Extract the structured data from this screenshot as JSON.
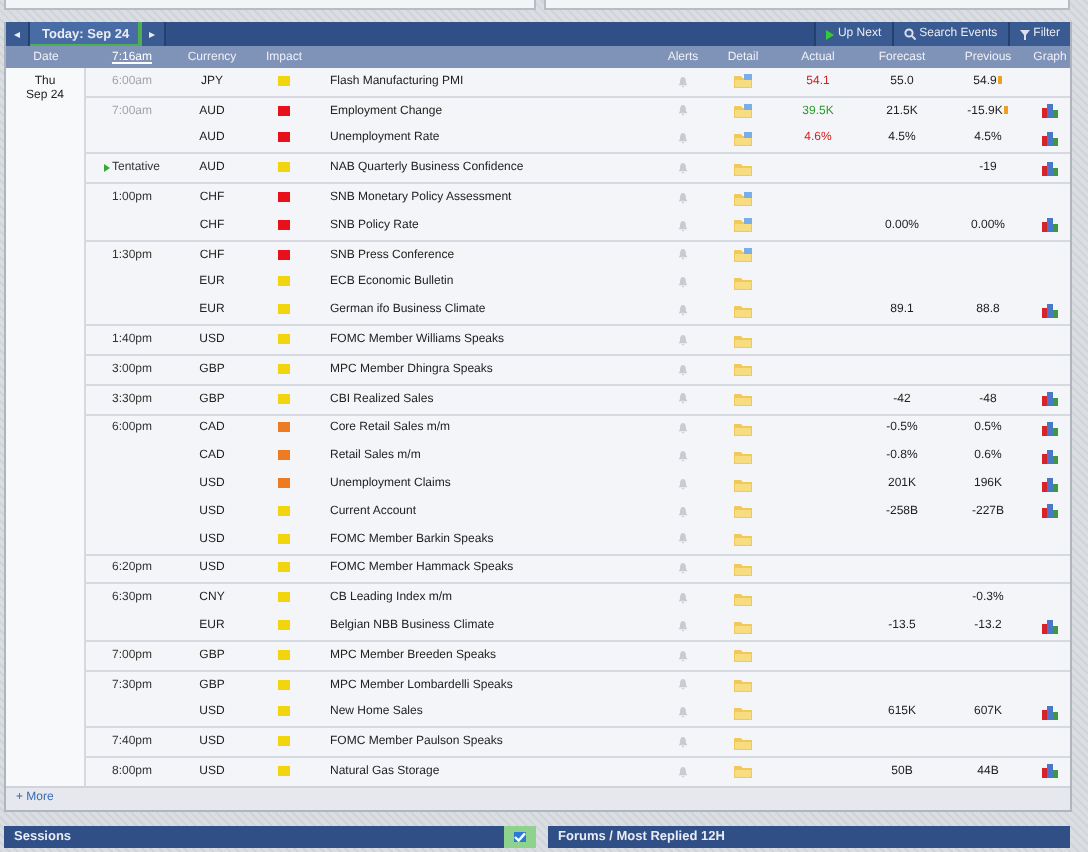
{
  "nav": {
    "prev": "◂",
    "tab": {
      "label": "Today: Sep 24",
      "selected": true
    },
    "next": "▸",
    "actions": [
      {
        "kind": "upnext",
        "label": "Up Next"
      },
      {
        "kind": "search",
        "label": "Search Events"
      },
      {
        "kind": "filter",
        "label": "Filter"
      }
    ]
  },
  "columns": {
    "date": "Date",
    "time": "7:16am",
    "currency": "Currency",
    "impact": "Impact",
    "alerts": "Alerts",
    "detail": "Detail",
    "actual": "Actual",
    "forecast": "Forecast",
    "previous": "Previous",
    "graph": "Graph"
  },
  "days": [
    {
      "weekday": "Thu",
      "date": "Sep 24",
      "groups": [
        {
          "time": "6:00am",
          "past": true,
          "tentative": false,
          "events": [
            {
              "currency": "JPY",
              "impact": {
                "color": "#f2d40f"
              },
              "title": "Flash Manufacturing PMI",
              "detail_updated": true,
              "actual": "54.1",
              "actual_better": false,
              "forecast": "55.0",
              "previous": "54.9",
              "previous_revised": true,
              "graph": false
            }
          ]
        },
        {
          "time": "7:00am",
          "past": true,
          "tentative": false,
          "events": [
            {
              "currency": "AUD",
              "impact": {
                "color": "#e8101a"
              },
              "title": "Employment Change",
              "detail_updated": true,
              "actual": "39.5K",
              "actual_better": true,
              "forecast": "21.5K",
              "previous": "-15.9K",
              "previous_revised": true,
              "graph": true
            },
            {
              "currency": "AUD",
              "impact": {
                "color": "#e8101a"
              },
              "title": "Unemployment Rate",
              "detail_updated": true,
              "actual": "4.6%",
              "actual_better": false,
              "forecast": "4.5%",
              "previous": "4.5%",
              "previous_revised": false,
              "graph": true
            }
          ]
        },
        {
          "time": "Tentative",
          "past": false,
          "tentative": true,
          "events": [
            {
              "currency": "AUD",
              "impact": {
                "color": "#f2d40f"
              },
              "title": "NAB Quarterly Business Confidence",
              "detail_updated": false,
              "previous": "-19",
              "previous_revised": false,
              "graph": true
            }
          ]
        },
        {
          "time": "1:00pm",
          "past": false,
          "tentative": false,
          "events": [
            {
              "currency": "CHF",
              "impact": {
                "color": "#e8101a"
              },
              "title": "SNB Monetary Policy Assessment",
              "detail_updated": true,
              "graph": false
            },
            {
              "currency": "CHF",
              "impact": {
                "color": "#e8101a"
              },
              "title": "SNB Policy Rate",
              "detail_updated": true,
              "forecast": "0.00%",
              "previous": "0.00%",
              "previous_revised": false,
              "graph": true
            }
          ]
        },
        {
          "time": "1:30pm",
          "past": false,
          "tentative": false,
          "events": [
            {
              "currency": "CHF",
              "impact": {
                "color": "#e8101a"
              },
              "title": "SNB Press Conference",
              "detail_updated": true,
              "graph": false
            },
            {
              "currency": "EUR",
              "impact": {
                "color": "#f2d40f"
              },
              "title": "ECB Economic Bulletin",
              "detail_updated": false,
              "graph": false
            },
            {
              "currency": "EUR",
              "impact": {
                "color": "#f2d40f"
              },
              "title": "German ifo Business Climate",
              "detail_updated": false,
              "forecast": "89.1",
              "previous": "88.8",
              "previous_revised": false,
              "graph": true
            }
          ]
        },
        {
          "time": "1:40pm",
          "past": false,
          "tentative": false,
          "events": [
            {
              "currency": "USD",
              "impact": {
                "color": "#f2d40f"
              },
              "title": "FOMC Member Williams Speaks",
              "detail_updated": false,
              "graph": false
            }
          ]
        },
        {
          "time": "3:00pm",
          "past": false,
          "tentative": false,
          "events": [
            {
              "currency": "GBP",
              "impact": {
                "color": "#f2d40f"
              },
              "title": "MPC Member Dhingra Speaks",
              "detail_updated": false,
              "graph": false
            }
          ]
        },
        {
          "time": "3:30pm",
          "past": false,
          "tentative": false,
          "events": [
            {
              "currency": "GBP",
              "impact": {
                "color": "#f2d40f"
              },
              "title": "CBI Realized Sales",
              "detail_updated": false,
              "forecast": "-42",
              "previous": "-48",
              "previous_revised": false,
              "graph": true
            }
          ]
        },
        {
          "time": "6:00pm",
          "past": false,
          "tentative": false,
          "events": [
            {
              "currency": "CAD",
              "impact": {
                "color": "#ee7a22"
              },
              "title": "Core Retail Sales m/m",
              "detail_updated": false,
              "forecast": "-0.5%",
              "previous": "0.5%",
              "previous_revised": false,
              "graph": true
            },
            {
              "currency": "CAD",
              "impact": {
                "color": "#ee7a22"
              },
              "title": "Retail Sales m/m",
              "detail_updated": false,
              "forecast": "-0.8%",
              "previous": "0.6%",
              "previous_revised": false,
              "graph": true
            },
            {
              "currency": "USD",
              "impact": {
                "color": "#ee7a22"
              },
              "title": "Unemployment Claims",
              "detail_updated": false,
              "forecast": "201K",
              "previous": "196K",
              "previous_revised": false,
              "graph": true
            },
            {
              "currency": "USD",
              "impact": {
                "color": "#f2d40f"
              },
              "title": "Current Account",
              "detail_updated": false,
              "forecast": "-258B",
              "previous": "-227B",
              "previous_revised": false,
              "graph": true
            },
            {
              "currency": "USD",
              "impact": {
                "color": "#f2d40f"
              },
              "title": "FOMC Member Barkin Speaks",
              "detail_updated": false,
              "graph": false
            }
          ]
        },
        {
          "time": "6:20pm",
          "past": false,
          "tentative": false,
          "events": [
            {
              "currency": "USD",
              "impact": {
                "color": "#f2d40f"
              },
              "title": "FOMC Member Hammack Speaks",
              "detail_updated": false,
              "graph": false
            }
          ]
        },
        {
          "time": "6:30pm",
          "past": false,
          "tentative": false,
          "events": [
            {
              "currency": "CNY",
              "impact": {
                "color": "#f2d40f"
              },
              "title": "CB Leading Index m/m",
              "detail_updated": false,
              "previous": "-0.3%",
              "previous_revised": false,
              "graph": false
            },
            {
              "currency": "EUR",
              "impact": {
                "color": "#f2d40f"
              },
              "title": "Belgian NBB Business Climate",
              "detail_updated": false,
              "forecast": "-13.5",
              "previous": "-13.2",
              "previous_revised": false,
              "graph": true
            }
          ]
        },
        {
          "time": "7:00pm",
          "past": false,
          "tentative": false,
          "events": [
            {
              "currency": "GBP",
              "impact": {
                "color": "#f2d40f"
              },
              "title": "MPC Member Breeden Speaks",
              "detail_updated": false,
              "graph": false
            }
          ]
        },
        {
          "time": "7:30pm",
          "past": false,
          "tentative": false,
          "events": [
            {
              "currency": "GBP",
              "impact": {
                "color": "#f2d40f"
              },
              "title": "MPC Member Lombardelli Speaks",
              "detail_updated": false,
              "graph": false
            },
            {
              "currency": "USD",
              "impact": {
                "color": "#f2d40f"
              },
              "title": "New Home Sales",
              "detail_updated": false,
              "forecast": "615K",
              "previous": "607K",
              "previous_revised": false,
              "graph": true
            }
          ]
        },
        {
          "time": "7:40pm",
          "past": false,
          "tentative": false,
          "events": [
            {
              "currency": "USD",
              "impact": {
                "color": "#f2d40f"
              },
              "title": "FOMC Member Paulson Speaks",
              "detail_updated": false,
              "graph": false
            }
          ]
        },
        {
          "time": "8:00pm",
          "past": false,
          "tentative": false,
          "events": [
            {
              "currency": "USD",
              "impact": {
                "color": "#f2d40f"
              },
              "title": "Natural Gas Storage",
              "detail_updated": false,
              "forecast": "50B",
              "previous": "44B",
              "previous_revised": false,
              "graph": true
            }
          ]
        }
      ]
    }
  ],
  "more": "+ More",
  "sessions": {
    "title": "Sessions",
    "checked": true
  },
  "forums": {
    "title": "Forums / Most Replied 12H"
  }
}
